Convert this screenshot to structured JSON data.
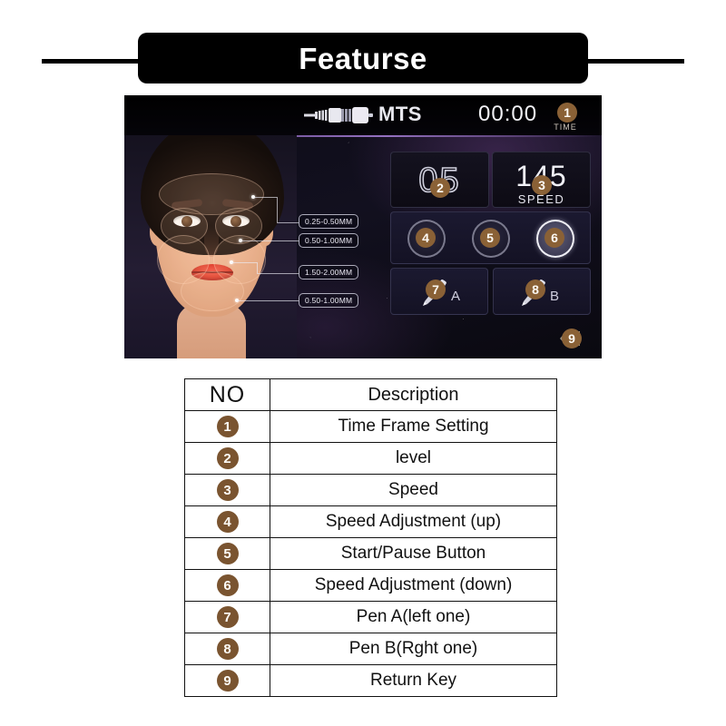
{
  "header": {
    "title": "Featurse"
  },
  "device": {
    "statusbar": {
      "pen_icon": "needle-cartridge-icon",
      "mode_label": "MTS",
      "timer": "00:00",
      "timer_caption": "TIME"
    },
    "level": {
      "value": "05"
    },
    "speed": {
      "value": "145",
      "caption": "SPEED"
    },
    "depth_labels": [
      "0.25-0.50MM",
      "0.50-1.00MM",
      "1.50-2.00MM",
      "0.50-1.00MM"
    ],
    "pen_buttons": [
      {
        "letter": "A",
        "icon": "pen-icon"
      },
      {
        "letter": "B",
        "icon": "pen-icon"
      }
    ],
    "return_key_icon": "return-arrow-icon",
    "badges": [
      "1",
      "2",
      "3",
      "4",
      "5",
      "6",
      "7",
      "8",
      "9"
    ]
  },
  "table": {
    "headers": {
      "no": "NO",
      "description": "Description"
    },
    "rows": [
      {
        "no": "1",
        "description": "Time Frame Setting"
      },
      {
        "no": "2",
        "description": "level"
      },
      {
        "no": "3",
        "description": "Speed"
      },
      {
        "no": "4",
        "description": "Speed Adjustment (up)"
      },
      {
        "no": "5",
        "description": "Start/Pause Button"
      },
      {
        "no": "6",
        "description": "Speed Adjustment (down)"
      },
      {
        "no": "7",
        "description": "Pen A(left one)"
      },
      {
        "no": "8",
        "description": "Pen B(Rght one)"
      },
      {
        "no": "9",
        "description": "Return Key"
      }
    ]
  },
  "colors": {
    "badge_brown": "#8a6136",
    "table_badge_brown": "#7a5430",
    "header_bg": "#000000",
    "header_text": "#ffffff",
    "table_border": "#111111"
  }
}
